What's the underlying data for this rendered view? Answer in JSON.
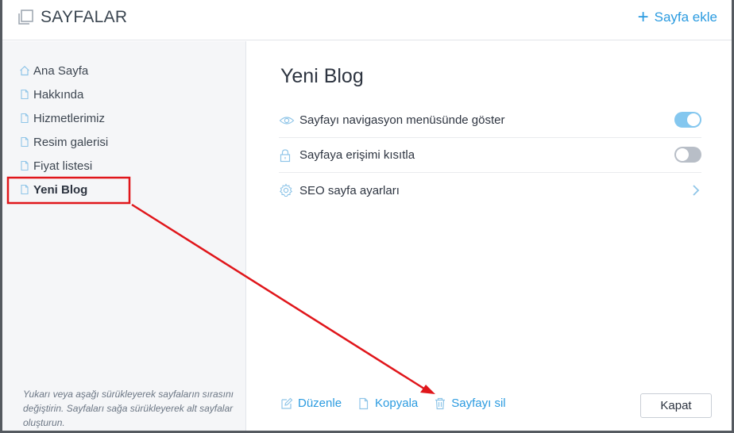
{
  "header": {
    "title": "SAYFALAR",
    "add_page_label": "Sayfa ekle"
  },
  "sidebar": {
    "items": [
      {
        "label": "Ana Sayfa",
        "icon": "home-icon"
      },
      {
        "label": "Hakkında",
        "icon": "page-icon"
      },
      {
        "label": "Hizmetlerimiz",
        "icon": "page-icon"
      },
      {
        "label": "Resim galerisi",
        "icon": "page-icon"
      },
      {
        "label": "Fiyat listesi",
        "icon": "page-icon"
      },
      {
        "label": "Yeni Blog",
        "icon": "page-icon",
        "active": true
      }
    ],
    "hint": "Yukarı veya aşağı sürükleyerek sayfaların sırasını değiştirin. Sayfaları sağa sürükleyerek alt sayfalar oluşturun."
  },
  "main": {
    "page_title": "Yeni Blog",
    "settings": [
      {
        "label": "Sayfayı navigasyon menüsünde göster",
        "icon": "eye-icon",
        "control": "toggle",
        "on": true
      },
      {
        "label": "Sayfaya erişimi kısıtla",
        "icon": "lock-icon",
        "control": "toggle",
        "on": false
      },
      {
        "label": "SEO sayfa ayarları",
        "icon": "gear-icon",
        "control": "chevron"
      }
    ],
    "actions": {
      "edit_label": "Düzenle",
      "copy_label": "Kopyala",
      "delete_label": "Sayfayı sil"
    },
    "close_label": "Kapat"
  },
  "colors": {
    "accent": "#2b9be0",
    "toggle_on": "#84c7ef",
    "toggle_off": "#b8bec7",
    "annotation": "#e0161b"
  }
}
